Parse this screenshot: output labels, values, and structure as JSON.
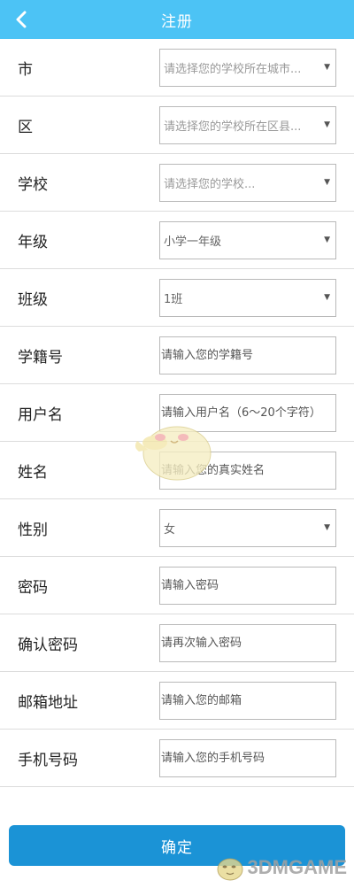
{
  "header": {
    "title": "注册"
  },
  "fields": [
    {
      "label": "市",
      "type": "select",
      "value": "请选择您的学校所在城市...",
      "placeholder": true
    },
    {
      "label": "区",
      "type": "select",
      "value": "请选择您的学校所在区县...",
      "placeholder": true
    },
    {
      "label": "学校",
      "type": "select",
      "value": "请选择您的学校...",
      "placeholder": true
    },
    {
      "label": "年级",
      "type": "select",
      "value": "小学一年级",
      "placeholder": false
    },
    {
      "label": "班级",
      "type": "select",
      "value": "1班",
      "placeholder": false
    },
    {
      "label": "学籍号",
      "type": "input",
      "placeholder": "请输入您的学籍号"
    },
    {
      "label": "用户名",
      "type": "input",
      "placeholder": "请输入用户名（6～20个字符）"
    },
    {
      "label": "姓名",
      "type": "input",
      "placeholder": "请输入您的真实姓名"
    },
    {
      "label": "性别",
      "type": "select",
      "value": "女",
      "placeholder": false
    },
    {
      "label": "密码",
      "type": "input",
      "placeholder": "请输入密码"
    },
    {
      "label": "确认密码",
      "type": "input",
      "placeholder": "请再次输入密码"
    },
    {
      "label": "邮箱地址",
      "type": "input",
      "placeholder": "请输入您的邮箱"
    },
    {
      "label": "手机号码",
      "type": "input",
      "placeholder": "请输入您的手机号码"
    }
  ],
  "submit": {
    "label": "确定"
  },
  "watermark": {
    "text": "3DMGAME"
  },
  "icons": {
    "back": "chevron-left-icon",
    "dropdown": "triangle-down-icon"
  },
  "colors": {
    "header": "#4cc3f5",
    "button": "#1b93d6"
  }
}
